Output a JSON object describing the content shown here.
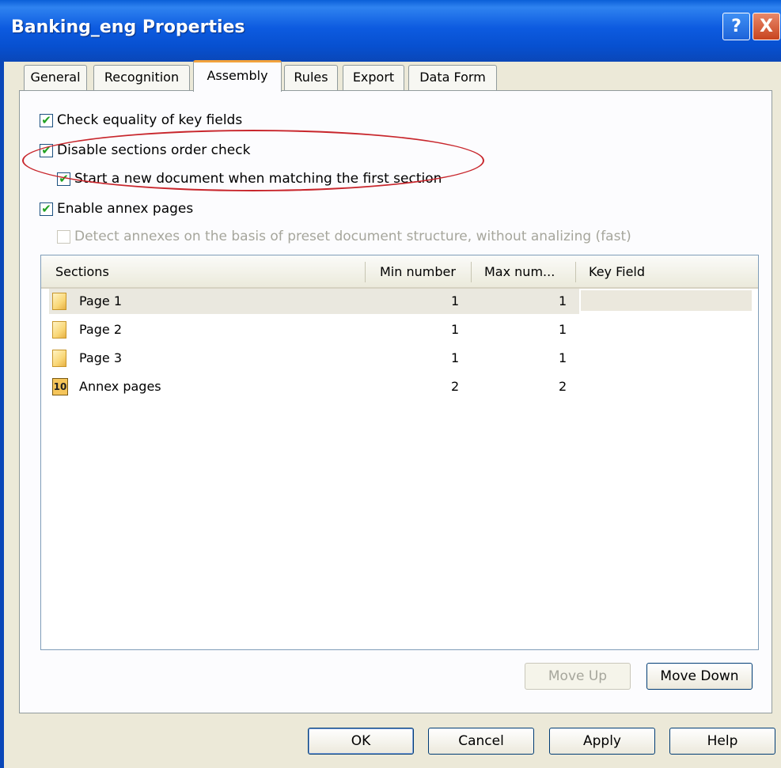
{
  "window": {
    "title": "Banking_eng Properties",
    "help_glyph": "?",
    "close_glyph": "X"
  },
  "tabs": [
    {
      "label": "General"
    },
    {
      "label": "Recognition"
    },
    {
      "label": "Assembly",
      "active": true
    },
    {
      "label": "Rules"
    },
    {
      "label": "Export"
    },
    {
      "label": "Data Form"
    }
  ],
  "options": {
    "check_equality": {
      "label": "Check equality of key fields",
      "checked": true
    },
    "disable_order": {
      "label": "Disable sections order check",
      "checked": true
    },
    "start_new_doc": {
      "label": "Start a new document when matching the first section",
      "checked": true
    },
    "enable_annex": {
      "label": "Enable annex pages",
      "checked": true
    },
    "detect_annex": {
      "label": "Detect annexes on the basis of preset document structure, without analizing (fast)",
      "checked": false,
      "disabled": true
    }
  },
  "sections_table": {
    "columns": [
      "Sections",
      "Min number",
      "Max num...",
      "Key Field"
    ],
    "rows": [
      {
        "name": "Page 1",
        "min": "1",
        "max": "1",
        "key": "",
        "icon": "page-icon"
      },
      {
        "name": "Page 2",
        "min": "1",
        "max": "1",
        "key": "",
        "icon": "page-icon"
      },
      {
        "name": "Page 3",
        "min": "1",
        "max": "1",
        "key": "",
        "icon": "page-icon"
      },
      {
        "name": "Annex pages",
        "min": "2",
        "max": "2",
        "key": "",
        "icon": "annex-pages-icon",
        "icon_glyph": "10"
      }
    ]
  },
  "buttons": {
    "move_up": "Move Up",
    "move_down": "Move Down",
    "ok": "OK",
    "cancel": "Cancel",
    "apply": "Apply",
    "help": "Help"
  },
  "colors": {
    "title_bar": "#0a5fd8",
    "highlight_oval": "#c8262c",
    "active_tab_accent": "#f2a23c"
  }
}
